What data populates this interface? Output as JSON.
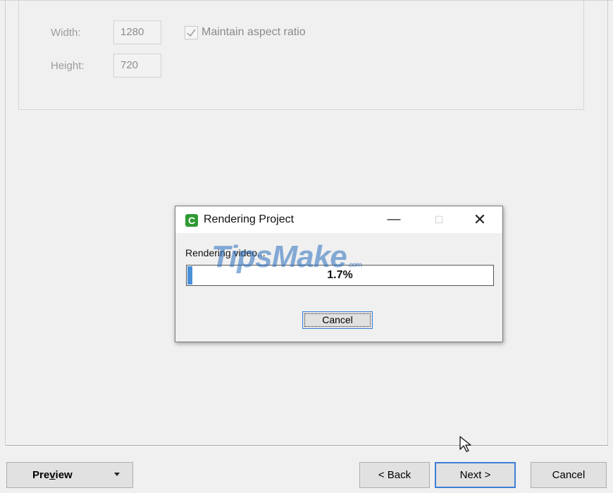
{
  "size_panel": {
    "width_label": "Width:",
    "width_value": "1280",
    "height_label": "Height:",
    "height_value": "720",
    "aspect_label": "Maintain aspect ratio",
    "aspect_checked": true
  },
  "footer": {
    "preview_label": "Preview",
    "preview_mnemonic": "v",
    "back_label": "< Back",
    "next_label": "Next >",
    "cancel_label": "Cancel"
  },
  "dialog": {
    "title": "Rendering Project",
    "app_icon_letter": "C",
    "status_text": "Rendering video...",
    "progress": 1.7,
    "progress_text": "1.7%",
    "cancel_label": "Cancel",
    "minimize_glyph": "—",
    "maximize_glyph": "☐",
    "close_glyph": "✕",
    "accent_color": "#3c7fd6",
    "icon_color": "#2f9a33"
  },
  "watermark": {
    "text": "TipsMake",
    "suffix": ".com"
  }
}
